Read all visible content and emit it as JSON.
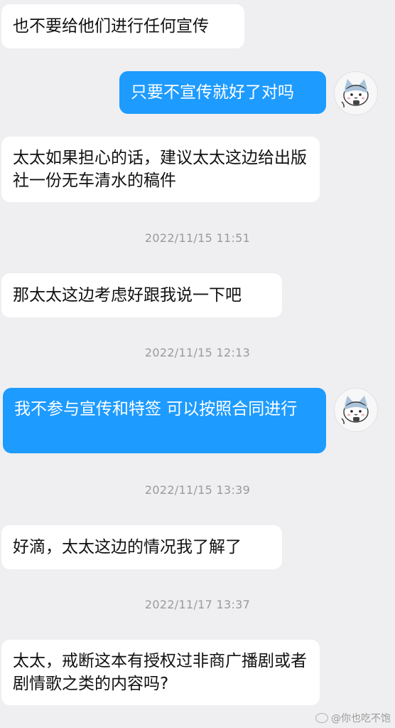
{
  "messages": [
    {
      "text": "也不要给他们进行任何宣传"
    },
    {
      "text": "只要不宣传就好了对吗"
    },
    {
      "text": "太太如果担心的话，建议太太这边给出版社一份无车清水的稿件"
    },
    {
      "timestamp": "2022/11/15 11:51"
    },
    {
      "text": "那太太这边考虑好跟我说一下吧"
    },
    {
      "timestamp": "2022/11/15 12:13"
    },
    {
      "text": "我不参与宣传和特签 可以按照合同进行"
    },
    {
      "timestamp": "2022/11/15 13:39"
    },
    {
      "text": "好滴，太太这边的情况我了解了"
    },
    {
      "timestamp": "2022/11/17 13:37"
    },
    {
      "text": "太太，戒断这本有授权过非商广播剧或者剧情歌之类的内容吗?"
    }
  ],
  "watermark": "@你也吃不饱",
  "colors": {
    "background": "#efeff1",
    "outgoing_bubble": "#1e9bff",
    "incoming_bubble": "#ffffff"
  }
}
